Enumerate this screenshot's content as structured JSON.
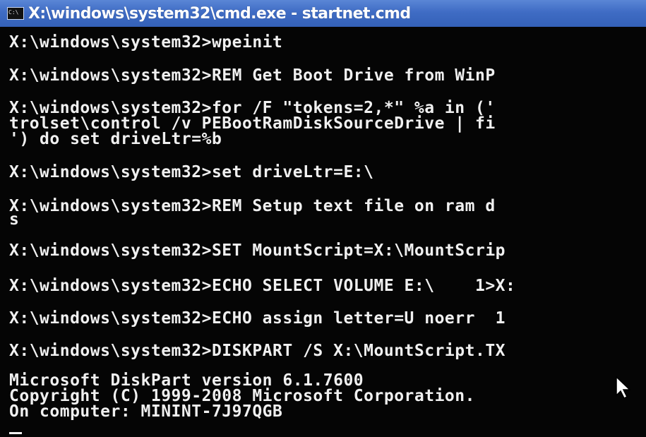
{
  "window": {
    "title": "X:\\windows\\system32\\cmd.exe - startnet.cmd",
    "icon": "console-icon"
  },
  "console": {
    "lines": [
      "X:\\windows\\system32>wpeinit",
      "X:\\windows\\system32>REM Get Boot Drive from WinP",
      "X:\\windows\\system32>for /F \"tokens=2,*\" %a in ('",
      "trolset\\control /v PEBootRamDiskSourceDrive | fi",
      "') do set driveLtr=%b",
      "X:\\windows\\system32>set driveLtr=E:\\",
      "X:\\windows\\system32>REM Setup text file on ram d",
      "s",
      "X:\\windows\\system32>SET MountScript=X:\\MountScrip",
      "X:\\windows\\system32>ECHO SELECT VOLUME E:\\    1>X:",
      "X:\\windows\\system32>ECHO assign letter=U noerr  1",
      "X:\\windows\\system32>DISKPART /S X:\\MountScript.TX",
      "Microsoft DiskPart version 6.1.7600",
      "Copyright (C) 1999-2008 Microsoft Corporation.",
      "On computer: MININT-7J97QGB"
    ]
  },
  "colors": {
    "title_bar": "#3f6cc4",
    "console_bg": "#050505",
    "console_text": "#f0f0f0"
  },
  "icons": [
    "console-icon",
    "mouse-pointer-icon"
  ]
}
